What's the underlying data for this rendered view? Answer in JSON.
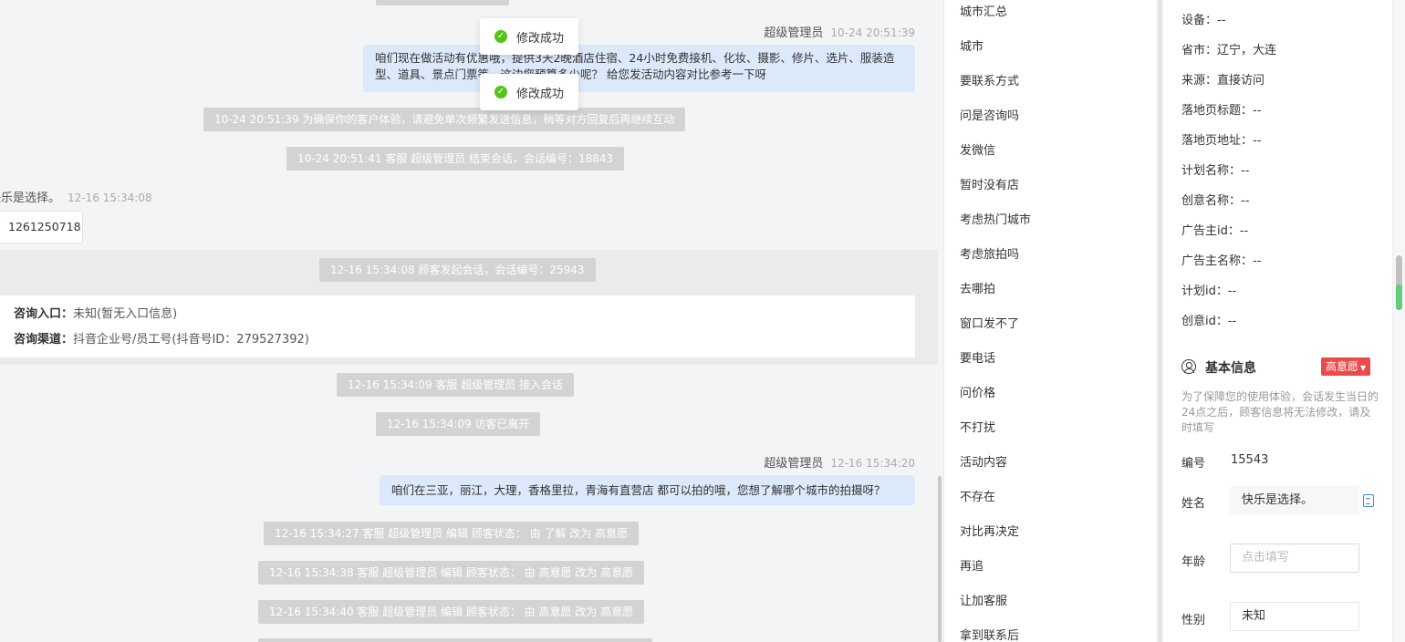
{
  "chat": {
    "agent_msg1": {
      "sender": "超级管理员",
      "time": "10-24 20:51:39",
      "text": "咱们现在做活动有优惠哦，提供3天2晚酒店住宿、24小时免费接机、化妆、摄影、修片、选片、服装造型、道具、景点门票等，这边您预算多少呢？ 给您发活动内容对比参考一下呀"
    },
    "sys1": "10-24 20:51:39 为确保你的客户体验，请避免单次频繁发送信息，稍等对方回复后再继续互动",
    "sys2": "10-24 20:51:41 客服 超级管理员 结束会话，会话编号：18843",
    "customer": {
      "name": "快乐是选择。",
      "time": "12-16 15:34:08",
      "card_text": "1261250718"
    },
    "sys3": "12-16 15:34:08 顾客发起会话，会话编号：25943",
    "entry": {
      "label1": "咨询入口：",
      "value1": "未知(暂无入口信息)",
      "label2": "咨询渠道：",
      "value2": "抖音企业号/员工号(抖音号ID：279527392)"
    },
    "sys4": "12-16 15:34:09 客服 超级管理员 接入会话",
    "sys5": "12-16 15:34:09 访客已离开",
    "agent_msg2": {
      "sender": "超级管理员",
      "time": "12-16 15:34:20",
      "text": "咱们在三亚，丽江，大理，香格里拉，青海有直营店 都可以拍的哦，您想了解哪个城市的拍摄呀？"
    },
    "sys6": "12-16 15:34:27 客服 超级管理员 编辑 顾客状态： 由 了解 改为 高意愿",
    "sys7": "12-16 15:34:38 客服 超级管理员 编辑 顾客状态： 由 高意愿 改为 高意愿",
    "sys8": "12-16 15:34:40 客服 超级管理员 编辑 顾客状态： 由 高意愿 改为 高意愿",
    "toast": "修改成功"
  },
  "quick_replies": [
    "城市汇总",
    "城市",
    "要联系方式",
    "问是咨询吗",
    "发微信",
    "暂时没有店",
    "考虑热门城市",
    "考虑旅拍吗",
    "去哪拍",
    "窗口发不了",
    "要电话",
    "问价格",
    "不打扰",
    "活动内容",
    "不存在",
    "对比再决定",
    "再追",
    "让加客服",
    "拿到联系后"
  ],
  "info": [
    "设备：--",
    "省市：辽宁，大连",
    "来源：直接访问",
    "落地页标题：--",
    "落地页地址：--",
    "计划名称：--",
    "创意名称：--",
    "广告主id：--",
    "广告主名称：--",
    "计划id：--",
    "创意id：--"
  ],
  "basic": {
    "title": "基本信息",
    "intent": "高意愿",
    "notice": "为了保障您的使用体验，会话发生当日的24点之后，顾客信息将无法修改，请及时填写",
    "id_label": "编号",
    "id_value": "15543",
    "name_label": "姓名",
    "name_value": "快乐是选择。",
    "age_label": "年龄",
    "age_placeholder": "点击填写",
    "gender_label": "性别",
    "gender_value": "未知"
  }
}
